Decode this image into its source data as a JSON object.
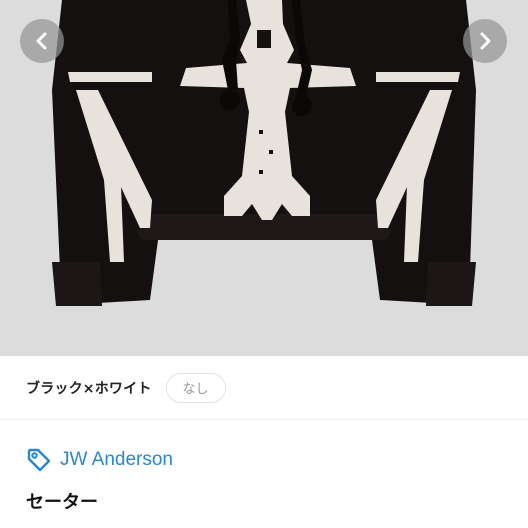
{
  "gallery": {
    "prev_icon": "chevron-left-icon",
    "next_icon": "chevron-right-icon",
    "image_colors": {
      "background": "#dcdcdc",
      "knit": "#141010",
      "motif": "#e8e2dc"
    }
  },
  "variant": {
    "color_label": "ブラック×ホワイト",
    "size_chip": "なし"
  },
  "brand": {
    "icon": "tag-icon",
    "name": "JW Anderson",
    "color": "#2a86d1"
  },
  "item": {
    "title": "セーター"
  }
}
